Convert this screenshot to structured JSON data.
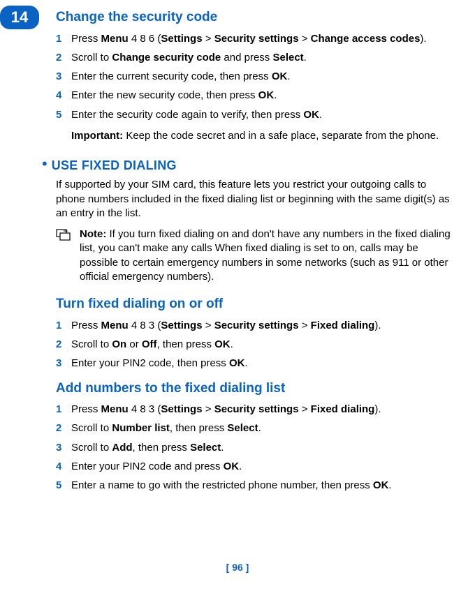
{
  "pageTab": "14",
  "section1": {
    "title": "Change the security code",
    "steps": [
      {
        "num": "1",
        "html": "Press <strong>Menu</strong> 4 8 6 (<strong>Settings</strong> > <strong>Security settings</strong> > <strong>Change access codes</strong>)."
      },
      {
        "num": "2",
        "html": "Scroll to <strong>Change security code</strong> and press <strong>Select</strong>."
      },
      {
        "num": "3",
        "html": "Enter the current security code, then press <strong>OK</strong>."
      },
      {
        "num": "4",
        "html": "Enter the new security code, then press <strong>OK</strong>."
      },
      {
        "num": "5",
        "html": "Enter the security code again to verify, then press <strong>OK</strong>."
      }
    ],
    "importantLabel": "Important:",
    "importantText": " Keep the code secret and in a safe place, separate from the phone."
  },
  "section2": {
    "title": "USE FIXED DIALING",
    "intro": "If supported by your SIM card, this feature lets you restrict your outgoing calls to phone numbers included in the fixed dialing list or beginning with the same digit(s) as an entry in the list.",
    "noteLabel": "Note:",
    "noteText": " If you turn fixed dialing on and don't have any numbers in the fixed dialing list, you can't make any calls When fixed dialing is set to on, calls may be possible to certain emergency numbers in some networks (such as 911 or other official emergency numbers)."
  },
  "section3": {
    "title": "Turn fixed dialing on or off",
    "steps": [
      {
        "num": "1",
        "html": "Press <strong>Menu</strong> 4 8 3 (<strong>Settings</strong> > <strong>Security settings</strong> > <strong>Fixed dialing</strong>)."
      },
      {
        "num": "2",
        "html": "Scroll to <strong>On</strong> or <strong>Off</strong>, then press <strong>OK</strong>."
      },
      {
        "num": "3",
        "html": "Enter your PIN2 code, then press <strong>OK</strong>."
      }
    ]
  },
  "section4": {
    "title": "Add numbers to the fixed dialing list",
    "steps": [
      {
        "num": "1",
        "html": "Press <strong>Menu</strong> 4 8 3 (<strong>Settings</strong> > <strong>Security settings</strong> > <strong>Fixed dialing</strong>)."
      },
      {
        "num": "2",
        "html": "Scroll to <strong>Number list</strong>, then press <strong>Select</strong>."
      },
      {
        "num": "3",
        "html": "Scroll to <strong>Add</strong>, then press <strong>Select</strong>."
      },
      {
        "num": "4",
        "html": "Enter your PIN2 code and press <strong>OK</strong>."
      },
      {
        "num": "5",
        "html": "Enter a name to go with the restricted phone number, then press <strong>OK</strong>."
      }
    ]
  },
  "footer": "[ 96 ]"
}
